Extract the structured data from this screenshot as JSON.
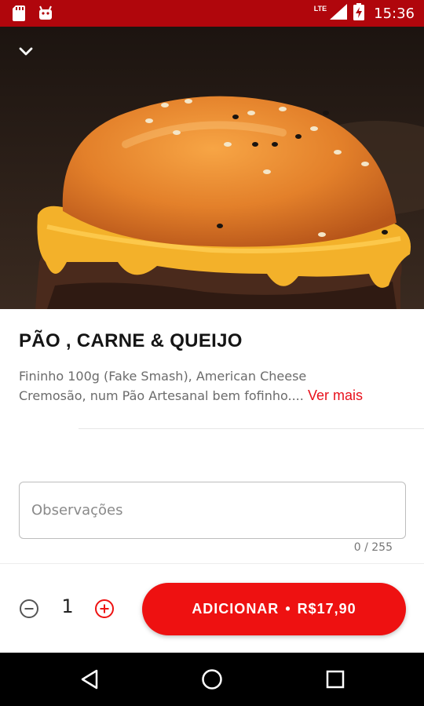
{
  "status_bar": {
    "network": "LTE",
    "time": "15:36",
    "icons": [
      "sd-card-icon",
      "android-debug-icon",
      "signal-icon",
      "battery-charging-icon"
    ]
  },
  "hero": {
    "image": "burger-photo",
    "collapse_icon": "chevron-down-icon"
  },
  "product": {
    "title": "PÃO , CARNE & QUEIJO",
    "description_line1": "Fininho 100g (Fake Smash), American Cheese",
    "description_line2": "Cremosão, num Pão Artesanal bem fofinho....",
    "see_more": "Ver mais"
  },
  "observations": {
    "placeholder": "Observações",
    "value": "",
    "counter": "0 / 255"
  },
  "order": {
    "quantity": "1",
    "add_label": "ADICIONAR",
    "separator": "•",
    "price": "R$17,90",
    "minus_icon": "minus-circle-icon",
    "plus_icon": "plus-circle-icon"
  },
  "nav": {
    "icons": [
      "back-icon",
      "home-icon",
      "recents-icon"
    ]
  },
  "colors": {
    "status_bar": "#b0060c",
    "accent": "#ee1111",
    "link": "#e8111c"
  }
}
